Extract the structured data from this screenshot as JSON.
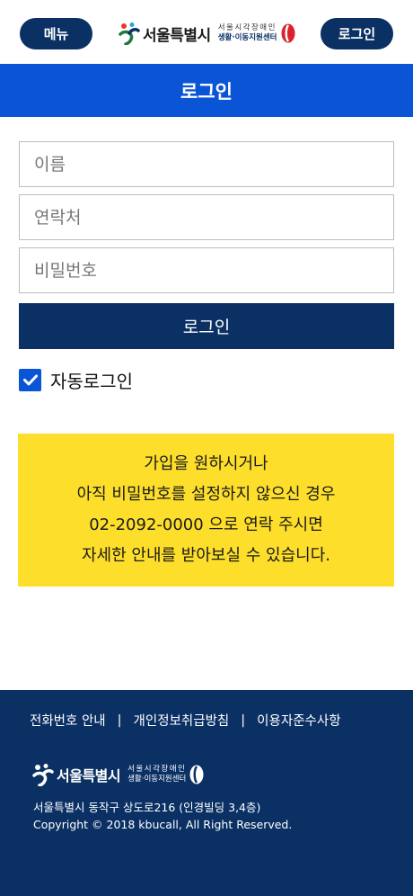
{
  "header": {
    "menu_label": "메뉴",
    "login_label": "로그인",
    "logo_main": "서울특별시",
    "logo_sub_line1": "서울시각장애인",
    "logo_sub_line2": "생활·이동지원센터"
  },
  "page_title": "로그인",
  "form": {
    "name_placeholder": "이름",
    "phone_placeholder": "연락처",
    "password_placeholder": "비밀번호",
    "submit_label": "로그인",
    "auto_login_label": "자동로그인",
    "auto_login_checked": true
  },
  "notice": {
    "lines": [
      "가입을 원하시거나",
      "아직 비밀번호를 설정하지 않으신 경우",
      "02-2092-0000 으로 연락 주시면",
      "자세한 안내를 받아보실 수 있습니다."
    ]
  },
  "footer": {
    "links": [
      "전화번호 안내",
      "개인정보취급방침",
      "이용자준수사항"
    ],
    "separator": "|",
    "logo_main": "서울특별시",
    "logo_sub_line1": "서울시각장애인",
    "logo_sub_line2": "생활·이동지원센터",
    "address": "서울특별시 동작구 상도로216 (인경빌딩 3,4층)",
    "copyright": "Copyright © 2018 kbucall, All Right Reserved."
  },
  "colors": {
    "navy": "#0b3064",
    "blue": "#0a55d6",
    "yellow": "#fcde2b"
  }
}
